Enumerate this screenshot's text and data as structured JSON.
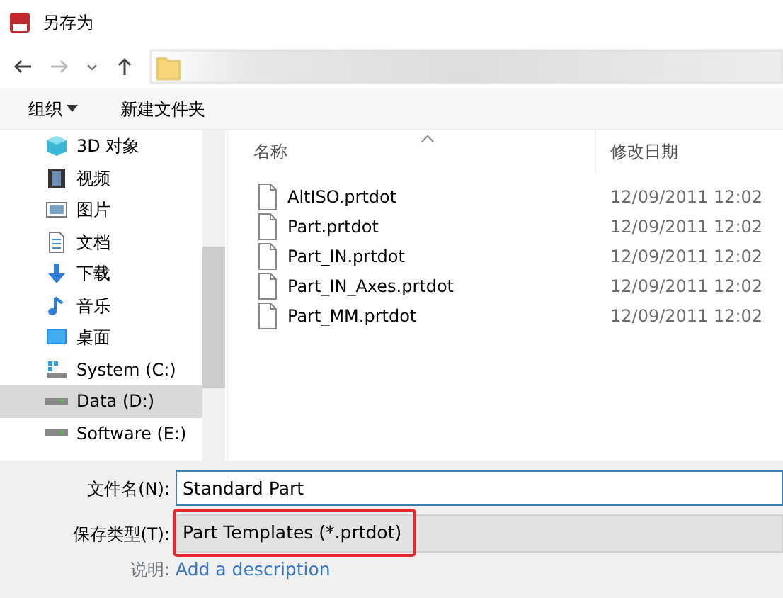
{
  "window": {
    "title": "另存为"
  },
  "toolbar": {
    "organize": "组织",
    "new_folder": "新建文件夹"
  },
  "sidebar": {
    "items": [
      {
        "label": "3D 对象",
        "kind": "cube",
        "selected": false
      },
      {
        "label": "视频",
        "kind": "film",
        "selected": false
      },
      {
        "label": "图片",
        "kind": "picture",
        "selected": false
      },
      {
        "label": "文档",
        "kind": "document",
        "selected": false
      },
      {
        "label": "下载",
        "kind": "download",
        "selected": false
      },
      {
        "label": "音乐",
        "kind": "music",
        "selected": false
      },
      {
        "label": "桌面",
        "kind": "desktop",
        "selected": false
      },
      {
        "label": "System (C:)",
        "kind": "system-drive",
        "selected": false
      },
      {
        "label": "Data (D:)",
        "kind": "drive",
        "selected": true
      },
      {
        "label": "Software (E:)",
        "kind": "drive",
        "selected": false
      }
    ]
  },
  "table": {
    "columns": [
      "名称",
      "修改日期"
    ],
    "rows": [
      {
        "name": "AltISO.prtdot",
        "date": "12/09/2011 12:02"
      },
      {
        "name": "Part.prtdot",
        "date": "12/09/2011 12:02"
      },
      {
        "name": "Part_IN.prtdot",
        "date": "12/09/2011 12:02"
      },
      {
        "name": "Part_IN_Axes.prtdot",
        "date": "12/09/2011 12:02"
      },
      {
        "name": "Part_MM.prtdot",
        "date": "12/09/2011 12:02"
      }
    ]
  },
  "form": {
    "filename_label": "文件名(N):",
    "filename": "Standard Part",
    "type_label": "保存类型(T):",
    "type": "Part Templates (*.prtdot)",
    "type_highlighted": true,
    "description_label": "说明:",
    "description_link": "Add a description"
  }
}
